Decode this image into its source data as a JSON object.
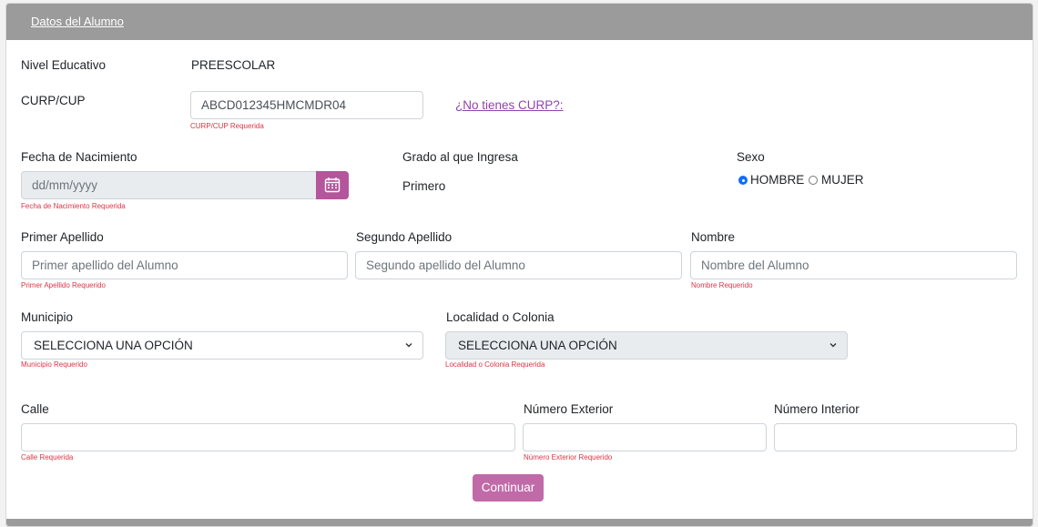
{
  "header": {
    "title": "Datos del Alumno"
  },
  "nivel": {
    "label": "Nivel Educativo",
    "value": "PREESCOLAR"
  },
  "curp": {
    "label": "CURP/CUP",
    "value": "ABCD012345HMCMDR04",
    "error": "CURP/CUP Requerida",
    "link": "¿No tienes CURP?:"
  },
  "fecha": {
    "label": "Fecha de Nacimiento",
    "placeholder": "dd/mm/yyyy",
    "error": "Fecha de Nacimiento Requerida"
  },
  "grado": {
    "label": "Grado al que Ingresa",
    "value": "Primero"
  },
  "sexo": {
    "label": "Sexo",
    "options": [
      {
        "label": "HOMBRE",
        "checked": true
      },
      {
        "label": "MUJER",
        "checked": false
      }
    ]
  },
  "primer_apellido": {
    "label": "Primer Apellido",
    "placeholder": "Primer apellido del Alumno",
    "error": "Primer Apellido Requerido"
  },
  "segundo_apellido": {
    "label": "Segundo Apellido",
    "placeholder": "Segundo apellido del Alumno"
  },
  "nombre": {
    "label": "Nombre",
    "placeholder": "Nombre del Alumno",
    "error": "Nombre Requerido"
  },
  "municipio": {
    "label": "Municipio",
    "selected": "SELECCIONA UNA OPCIÓN",
    "error": "Municipio Requerido"
  },
  "localidad": {
    "label": "Localidad o Colonia",
    "selected": "SELECCIONA UNA OPCIÓN",
    "error": "Localidad o Colonia Requerida"
  },
  "calle": {
    "label": "Calle",
    "value": "",
    "error": "Calle Requerida"
  },
  "num_ext": {
    "label": "Número Exterior",
    "value": "",
    "error": "Número Exterior Requerido"
  },
  "num_int": {
    "label": "Número Interior",
    "value": ""
  },
  "actions": {
    "continue": "Continuar"
  },
  "colors": {
    "header": "#9b9b9b",
    "accent": "#c06aa8",
    "error": "#dc3545",
    "link": "#8e44ad"
  }
}
